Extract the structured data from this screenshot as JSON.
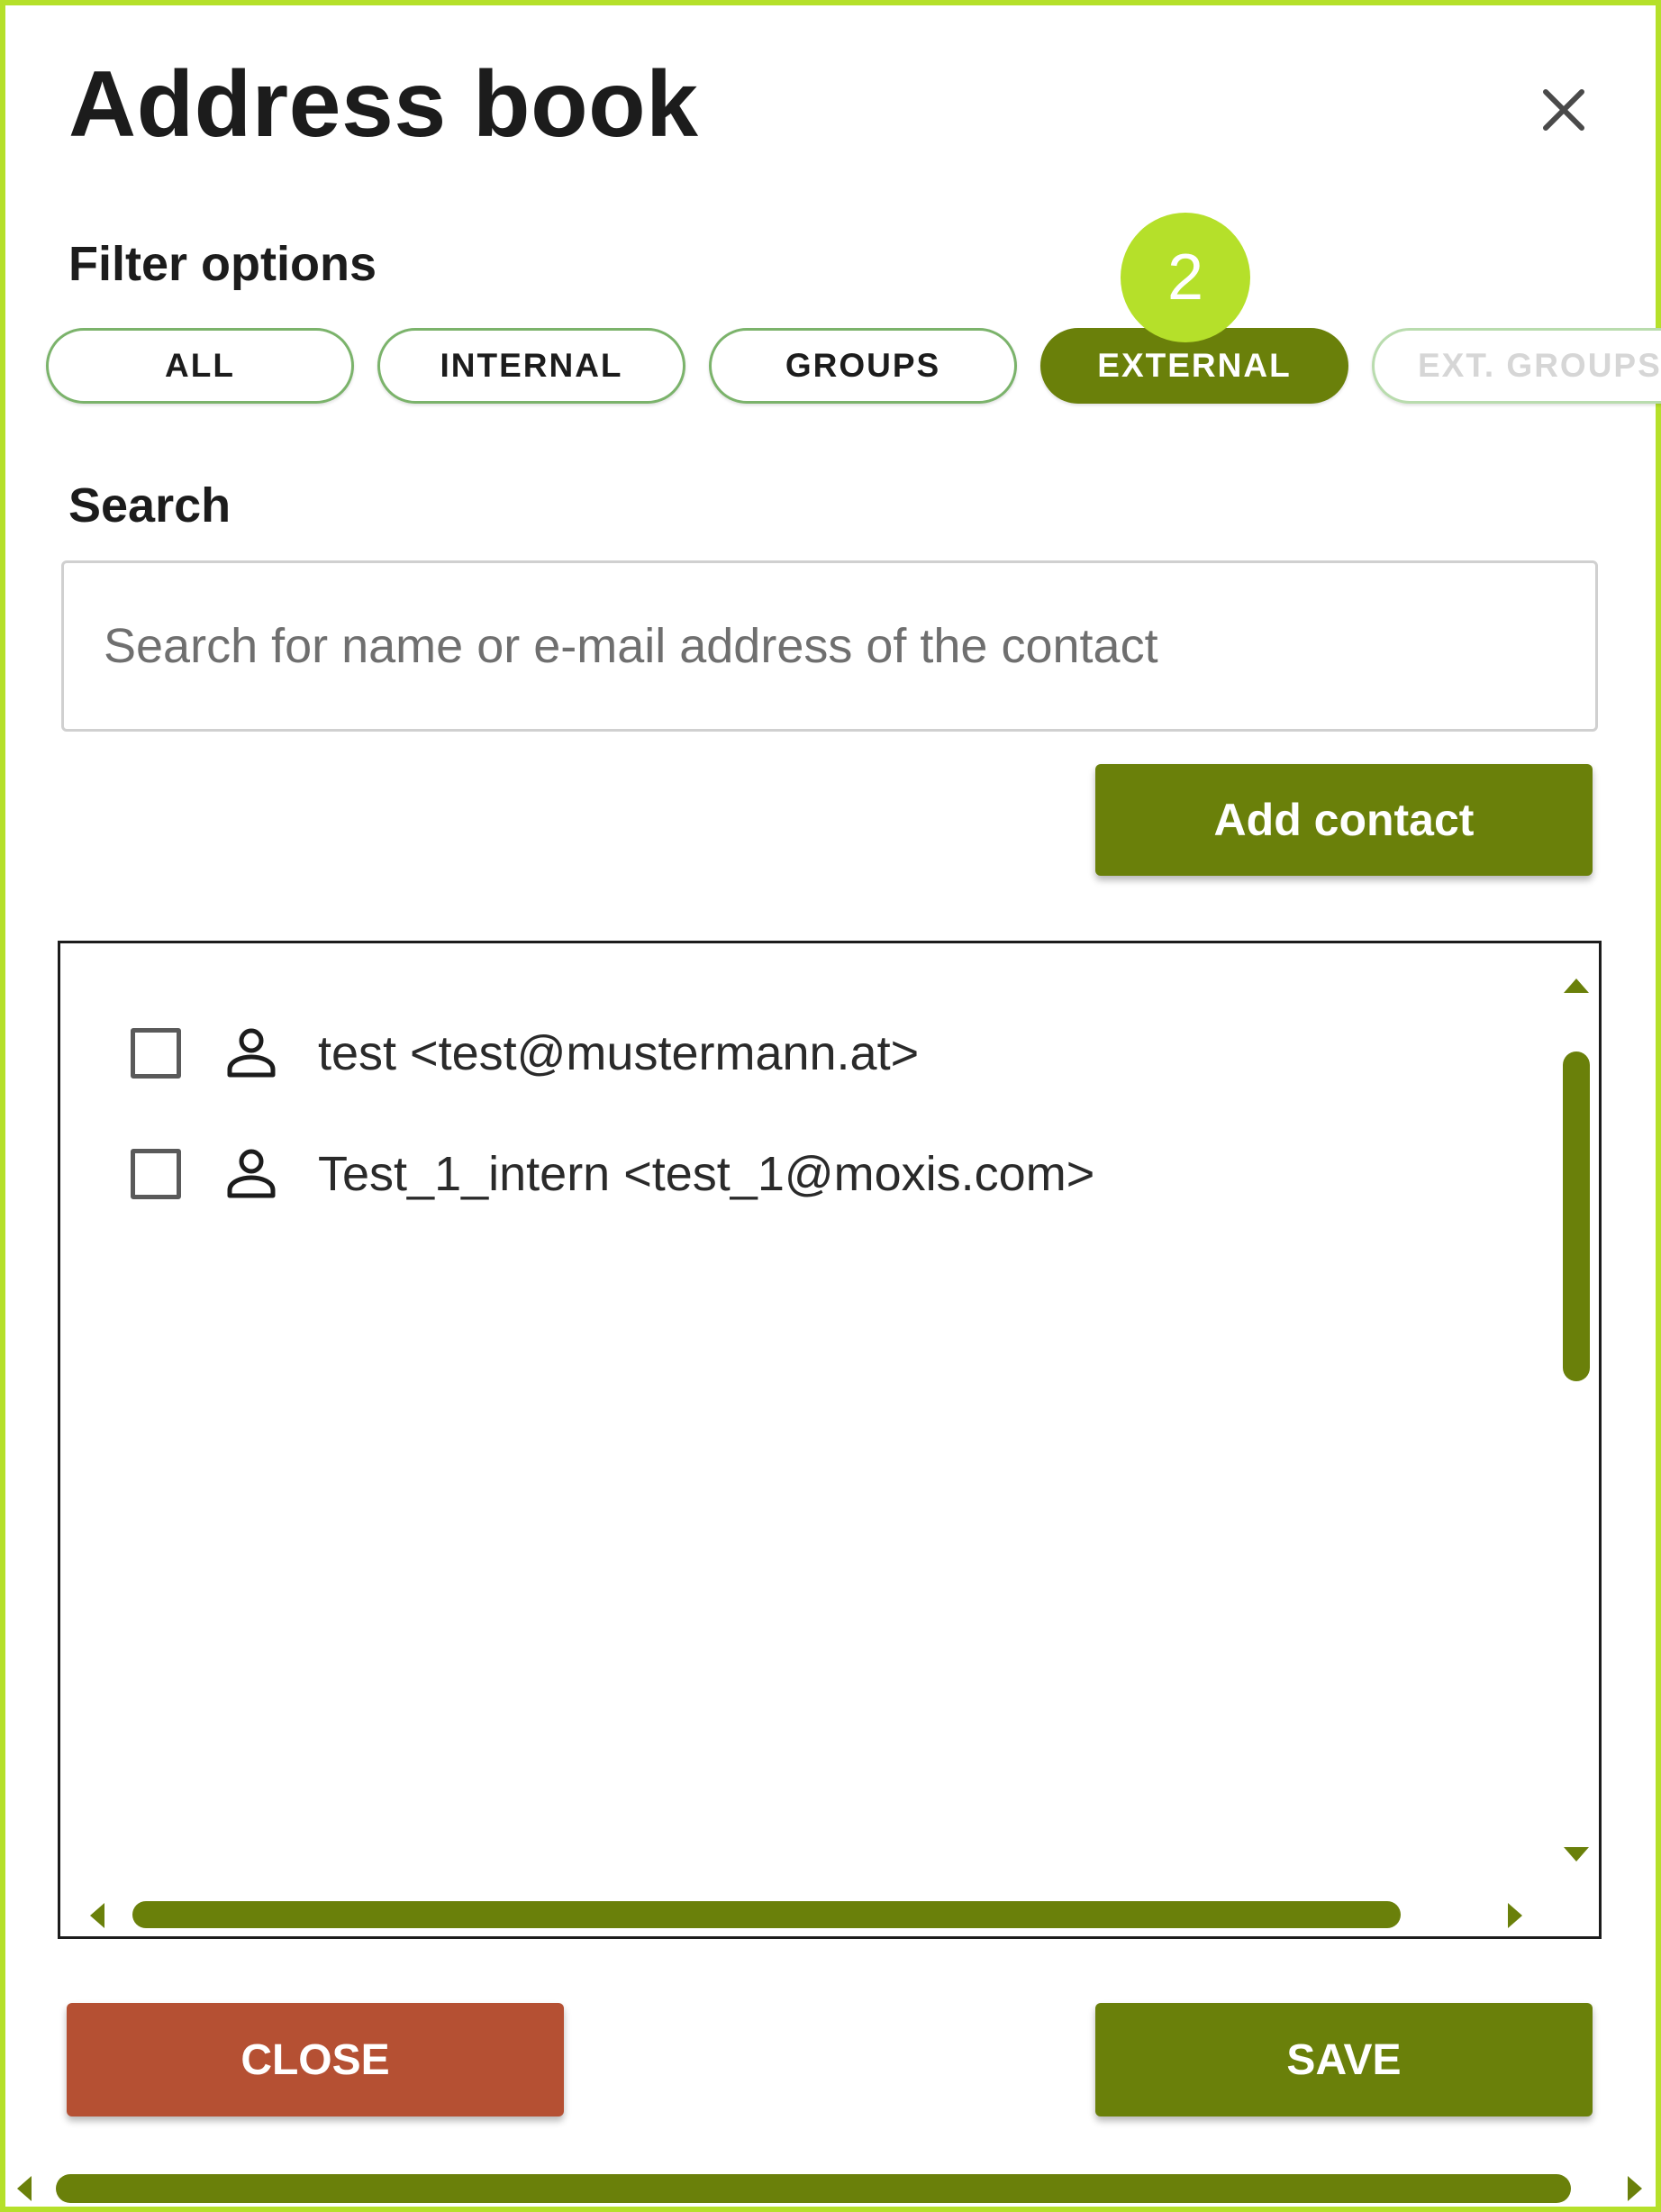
{
  "dialog": {
    "title": "Address book",
    "close_icon": "close-icon"
  },
  "filter": {
    "label": "Filter options",
    "chips": [
      {
        "label": "ALL",
        "active": false
      },
      {
        "label": "INTERNAL",
        "active": false
      },
      {
        "label": "GROUPS",
        "active": false
      },
      {
        "label": "EXTERNAL",
        "active": true
      },
      {
        "label": "EXT. GROUPS",
        "active": false,
        "disabled": true
      }
    ],
    "step_badge": "2"
  },
  "search": {
    "label": "Search",
    "placeholder": "Search for name or e-mail address of the contact",
    "value": ""
  },
  "actions": {
    "add_contact_label": "Add contact",
    "close_label": "CLOSE",
    "save_label": "SAVE"
  },
  "contacts": [
    {
      "text": "test <test@mustermann.at>",
      "checked": false,
      "icon": "person-icon"
    },
    {
      "text": "Test_1_intern <test_1@moxis.com>",
      "checked": false,
      "icon": "person-icon"
    }
  ],
  "colors": {
    "accent_green": "#6a800a",
    "badge_lime": "#b5e02a",
    "close_red": "#b55033",
    "chip_border": "#7bb36b"
  }
}
